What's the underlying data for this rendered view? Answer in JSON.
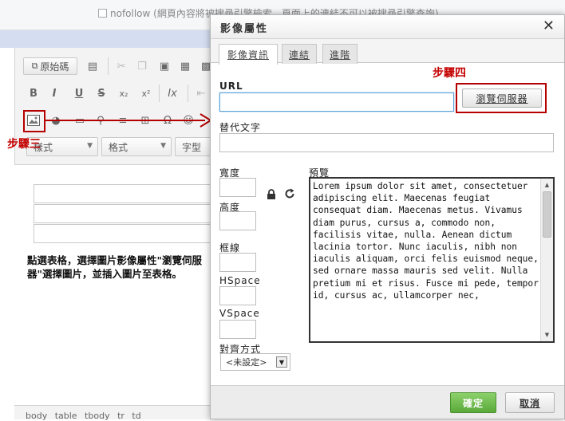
{
  "background": {
    "nofollow_label": "nofollow (網頁內容將被搜尋引擎檢索，頁面上的連結不可以被搜尋引擎查詢)",
    "source_button": "原始碼",
    "format_combo": "格式",
    "style_combo": "樣式",
    "font_combo": "字型",
    "instruction": "點選表格，選擇圖片影像屬性\"瀏覽伺服器\"選擇圖片，並插入圖片至表格。",
    "statusbar": "body  table  tbody  tr  td",
    "step3_label": "步驟三",
    "toolbar_glyphs": {
      "bold": "B",
      "italic": "I",
      "underline": "U",
      "strike": "S",
      "subscript": "x₂",
      "superscript": "x²",
      "remove_format": "Ix"
    }
  },
  "dialog": {
    "title": "影像屬性",
    "close": "✕",
    "tabs": [
      {
        "label": "影像資訊",
        "active": true
      },
      {
        "label": "連結",
        "active": false
      },
      {
        "label": "進階",
        "active": false
      }
    ],
    "url_label": "URL",
    "url_value": "",
    "browse_button": "瀏覽伺服器",
    "step4_label": "步驟四",
    "alt_label": "替代文字",
    "alt_value": "",
    "width_label": "寬度",
    "height_label": "高度",
    "border_label": "框線",
    "hspace_label": "HSpace",
    "vspace_label": "VSpace",
    "align_label": "對齊方式",
    "align_value": "<未設定>",
    "preview_label": "預覽",
    "preview_text": "Lorem ipsum dolor sit amet, consectetuer adipiscing elit. Maecenas feugiat consequat diam. Maecenas metus. Vivamus diam purus, cursus a, commodo non, facilisis vitae, nulla. Aenean dictum lacinia tortor. Nunc iaculis, nibh non iaculis aliquam, orci felis euismod neque, sed ornare massa mauris sed velit. Nulla pretium mi et risus. Fusce mi pede, tempor id, cursus ac, ullamcorper nec,",
    "ok_button": "確定",
    "cancel_button": "取消"
  },
  "colors": {
    "annotation_red": "#b40000",
    "ok_green": "#5aa93a",
    "focus_blue": "#57a0d9"
  }
}
